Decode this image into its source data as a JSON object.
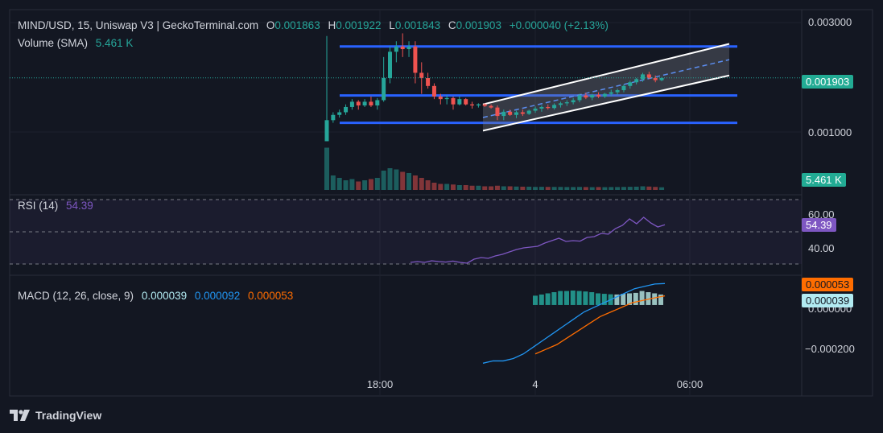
{
  "header": {
    "title": "MIND/USD, 15, Uniswap V3 | GeckoTerminal.com",
    "o_label": "O",
    "o_value": "0.001863",
    "h_label": "H",
    "h_value": "0.001922",
    "l_label": "L",
    "l_value": "0.001843",
    "c_label": "C",
    "c_value": "0.001903",
    "change": "+0.000040 (+2.13%)",
    "volume_label": "Volume (SMA)",
    "volume_value": "5.461 K"
  },
  "price_axis": {
    "ticks": [
      "0.003000",
      "0.001000"
    ],
    "last_price": "0.001903"
  },
  "volume_tag": "5.461 K",
  "rsi": {
    "label": "RSI (14)",
    "value": "54.39",
    "ticks": [
      "60.00",
      "40.00"
    ],
    "tag": "54.39"
  },
  "macd": {
    "label": "MACD (12, 26, close, 9)",
    "macd_value": "0.000039",
    "signal_value": "0.000092",
    "hist_value": "0.000053",
    "ticks": [
      "0.000000",
      "−0.000200"
    ],
    "tag_orange": "0.000053",
    "tag_white": "0.000039"
  },
  "time_axis": [
    "18:00",
    "4",
    "06:00"
  ],
  "brand": "TradingView",
  "colors": {
    "up": "#26a69a",
    "down": "#ef5350",
    "blue_line": "#2962ff",
    "rsi": "#7e57c2",
    "macd": "#2196f3",
    "signal": "#ff6d00",
    "bg": "#131722"
  },
  "icons": [
    "tradingview-logo-icon"
  ],
  "chart_data": [
    {
      "type": "candlestick",
      "title": "MIND/USD, 15, Uniswap V3 | GeckoTerminal.com",
      "ylim": [
        0.0006,
        0.0032
      ],
      "candles": [
        [
          0.0007,
          0.0027,
          0.0007,
          0.0011
        ],
        [
          0.0011,
          0.00125,
          0.00105,
          0.0012
        ],
        [
          0.0012,
          0.0013,
          0.00115,
          0.00125
        ],
        [
          0.00125,
          0.0014,
          0.0012,
          0.00135
        ],
        [
          0.00135,
          0.0015,
          0.0013,
          0.00145
        ],
        [
          0.00145,
          0.00148,
          0.0013,
          0.00138
        ],
        [
          0.00138,
          0.0015,
          0.00135,
          0.00145
        ],
        [
          0.00145,
          0.00155,
          0.00135,
          0.00138
        ],
        [
          0.00138,
          0.00152,
          0.0013,
          0.00148
        ],
        [
          0.00148,
          0.0023,
          0.00145,
          0.0019
        ],
        [
          0.0019,
          0.0025,
          0.0018,
          0.0024
        ],
        [
          0.0024,
          0.0026,
          0.0022,
          0.0025
        ],
        [
          0.0025,
          0.00275,
          0.0023,
          0.00245
        ],
        [
          0.00245,
          0.0026,
          0.0023,
          0.0025
        ],
        [
          0.0025,
          0.0026,
          0.0018,
          0.002
        ],
        [
          0.002,
          0.0022,
          0.0016,
          0.0019
        ],
        [
          0.0019,
          0.002,
          0.0017,
          0.00175
        ],
        [
          0.00175,
          0.0018,
          0.0015,
          0.00155
        ],
        [
          0.00155,
          0.0016,
          0.0014,
          0.0015
        ],
        [
          0.0015,
          0.00158,
          0.0014,
          0.00152
        ],
        [
          0.00152,
          0.00155,
          0.0013,
          0.0014
        ],
        [
          0.0014,
          0.00155,
          0.00138,
          0.0015
        ],
        [
          0.0015,
          0.00152,
          0.00138,
          0.0014
        ],
        [
          0.0014,
          0.00145,
          0.00132,
          0.00138
        ],
        [
          0.00138,
          0.00142,
          0.00134,
          0.0014
        ],
        [
          0.0014,
          0.00142,
          0.00135,
          0.00137
        ],
        [
          0.00137,
          0.0014,
          0.00132,
          0.00134
        ],
        [
          0.00134,
          0.00138,
          0.0011,
          0.00118
        ],
        [
          0.00118,
          0.0013,
          0.0011,
          0.00126
        ],
        [
          0.00126,
          0.0013,
          0.00118,
          0.0012
        ],
        [
          0.0012,
          0.00128,
          0.00114,
          0.00125
        ],
        [
          0.00125,
          0.0013,
          0.00118,
          0.00122
        ],
        [
          0.00122,
          0.0013,
          0.0012,
          0.00128
        ],
        [
          0.00128,
          0.00136,
          0.00124,
          0.00132
        ],
        [
          0.00132,
          0.00138,
          0.00126,
          0.00135
        ],
        [
          0.00135,
          0.0014,
          0.0013,
          0.00133
        ],
        [
          0.00133,
          0.00142,
          0.0013,
          0.00139
        ],
        [
          0.00139,
          0.00145,
          0.00134,
          0.00142
        ],
        [
          0.00142,
          0.00148,
          0.00137,
          0.00144
        ],
        [
          0.00144,
          0.00152,
          0.0014,
          0.00148
        ],
        [
          0.00148,
          0.0016,
          0.00144,
          0.00157
        ],
        [
          0.00157,
          0.00162,
          0.0015,
          0.00153
        ],
        [
          0.00153,
          0.0016,
          0.00148,
          0.00158
        ],
        [
          0.00158,
          0.00163,
          0.00152,
          0.00155
        ],
        [
          0.00155,
          0.00162,
          0.00152,
          0.0016
        ],
        [
          0.0016,
          0.00168,
          0.00156,
          0.00163
        ],
        [
          0.00163,
          0.0017,
          0.00158,
          0.00167
        ],
        [
          0.00167,
          0.00178,
          0.00163,
          0.00175
        ],
        [
          0.00175,
          0.00185,
          0.0017,
          0.00182
        ],
        [
          0.00182,
          0.0019,
          0.00178,
          0.00188
        ],
        [
          0.00188,
          0.002,
          0.00183,
          0.00197
        ],
        [
          0.00197,
          0.00202,
          0.00188,
          0.0019
        ],
        [
          0.0019,
          0.00195,
          0.00182,
          0.00186
        ],
        [
          0.00186,
          0.00192,
          0.00184,
          0.0019
        ]
      ],
      "volumes": [
        3.5,
        1.2,
        1,
        0.8,
        0.9,
        0.7,
        0.8,
        0.9,
        1,
        1.6,
        1.8,
        1.7,
        1.5,
        1.4,
        1.2,
        1,
        0.8,
        0.6,
        0.5,
        0.5,
        0.45,
        0.4,
        0.4,
        0.35,
        0.35,
        0.3,
        0.3,
        0.35,
        0.3,
        0.3,
        0.28,
        0.27,
        0.27,
        0.25,
        0.26,
        0.25,
        0.25,
        0.25,
        0.24,
        0.24,
        0.25,
        0.24,
        0.23,
        0.24,
        0.23,
        0.24,
        0.24,
        0.25,
        0.26,
        0.27,
        0.3,
        0.28,
        0.25,
        0.22
      ],
      "horizontal_lines": [
        0.0025,
        0.00157,
        0.00105
      ],
      "channel": {
        "upper": [
          0.0014,
          0.00255
        ],
        "lower": [
          0.0009,
          0.00195
        ],
        "mid": [
          0.00115,
          0.00225
        ]
      }
    },
    {
      "type": "line",
      "title": "RSI (14)",
      "ylim": [
        30,
        70
      ],
      "bands": [
        70,
        50,
        30
      ],
      "values": [
        31,
        31.5,
        31,
        32,
        31.5,
        31.2,
        31.8,
        31,
        30.5,
        33,
        34,
        33.5,
        35,
        36,
        37.5,
        39,
        40,
        40.5,
        41,
        43,
        44.5,
        46,
        44,
        44.5,
        44.2,
        46.5,
        47,
        49,
        48.5,
        52,
        54,
        58,
        55,
        59,
        55.5,
        53,
        54.39
      ]
    },
    {
      "type": "line",
      "title": "MACD (12, 26, close, 9)",
      "ylim": [
        -0.00028,
        0.0001
      ],
      "series": [
        {
          "name": "MACD",
          "values": [
            -0.00025,
            -0.00024,
            -0.00024,
            -0.00023,
            -0.00021,
            -0.00018,
            -0.00015,
            -0.00012,
            -9e-05,
            -6e-05,
            -3e-05,
            -1e-05,
            1e-05,
            3e-05,
            5e-05,
            7e-05,
            8e-05,
            9e-05,
            9.2e-05
          ]
        },
        {
          "name": "Signal",
          "values": [
            -0.00021,
            -0.00019,
            -0.00017,
            -0.00014,
            -0.00011,
            -8e-05,
            -5e-05,
            -3e-05,
            -1e-05,
            1e-05,
            2e-05,
            3e-05,
            3.9e-05
          ]
        }
      ],
      "histogram": [
        4e-05,
        4.5e-05,
        5e-05,
        5.5e-05,
        6e-05,
        6e-05,
        6.2e-05,
        6e-05,
        5.8e-05,
        5.5e-05,
        5e-05,
        4.8e-05,
        4.6e-05,
        4.5e-05,
        4.8e-05,
        5e-05,
        5.2e-05,
        6e-05,
        5.5e-05,
        5e-05,
        4.5e-05
      ]
    }
  ]
}
